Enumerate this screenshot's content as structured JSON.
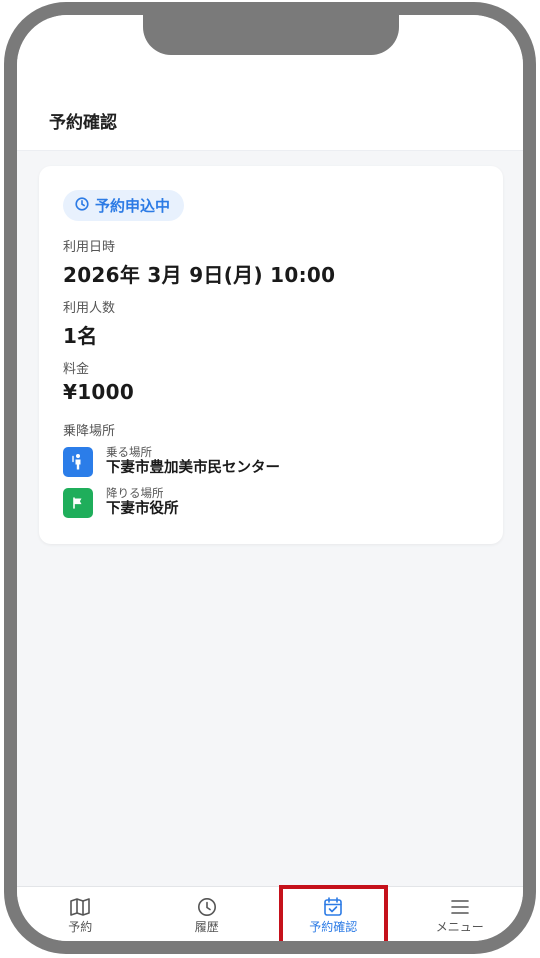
{
  "header": {
    "title": "予約確認"
  },
  "reservation": {
    "status": "予約申込中",
    "datetime_label": "利用日時",
    "datetime_value": "2026年 3月 9日(月) 10:00",
    "people_label": "利用人数",
    "people_value": "1名",
    "fee_label": "料金",
    "fee_value": "¥1000",
    "places_label": "乗降場所",
    "pickup": {
      "label": "乗る場所",
      "name": "下妻市豊加美市民センター",
      "icon": "person-pin-icon"
    },
    "dropoff": {
      "label": "降りる場所",
      "name": "下妻市役所",
      "icon": "flag-icon"
    }
  },
  "tabs": [
    {
      "label": "予約",
      "icon": "map-icon"
    },
    {
      "label": "履歴",
      "icon": "clock-icon"
    },
    {
      "label": "予約確認",
      "icon": "calendar-check-icon",
      "active": true
    },
    {
      "label": "メニュー",
      "icon": "menu-icon"
    }
  ],
  "colors": {
    "accent": "#2c7be5",
    "pickup_icon_bg": "#2b7de9",
    "dropoff_icon_bg": "#1fae5b",
    "highlight_border": "#c5111b",
    "frame": "#7a7a7a"
  }
}
